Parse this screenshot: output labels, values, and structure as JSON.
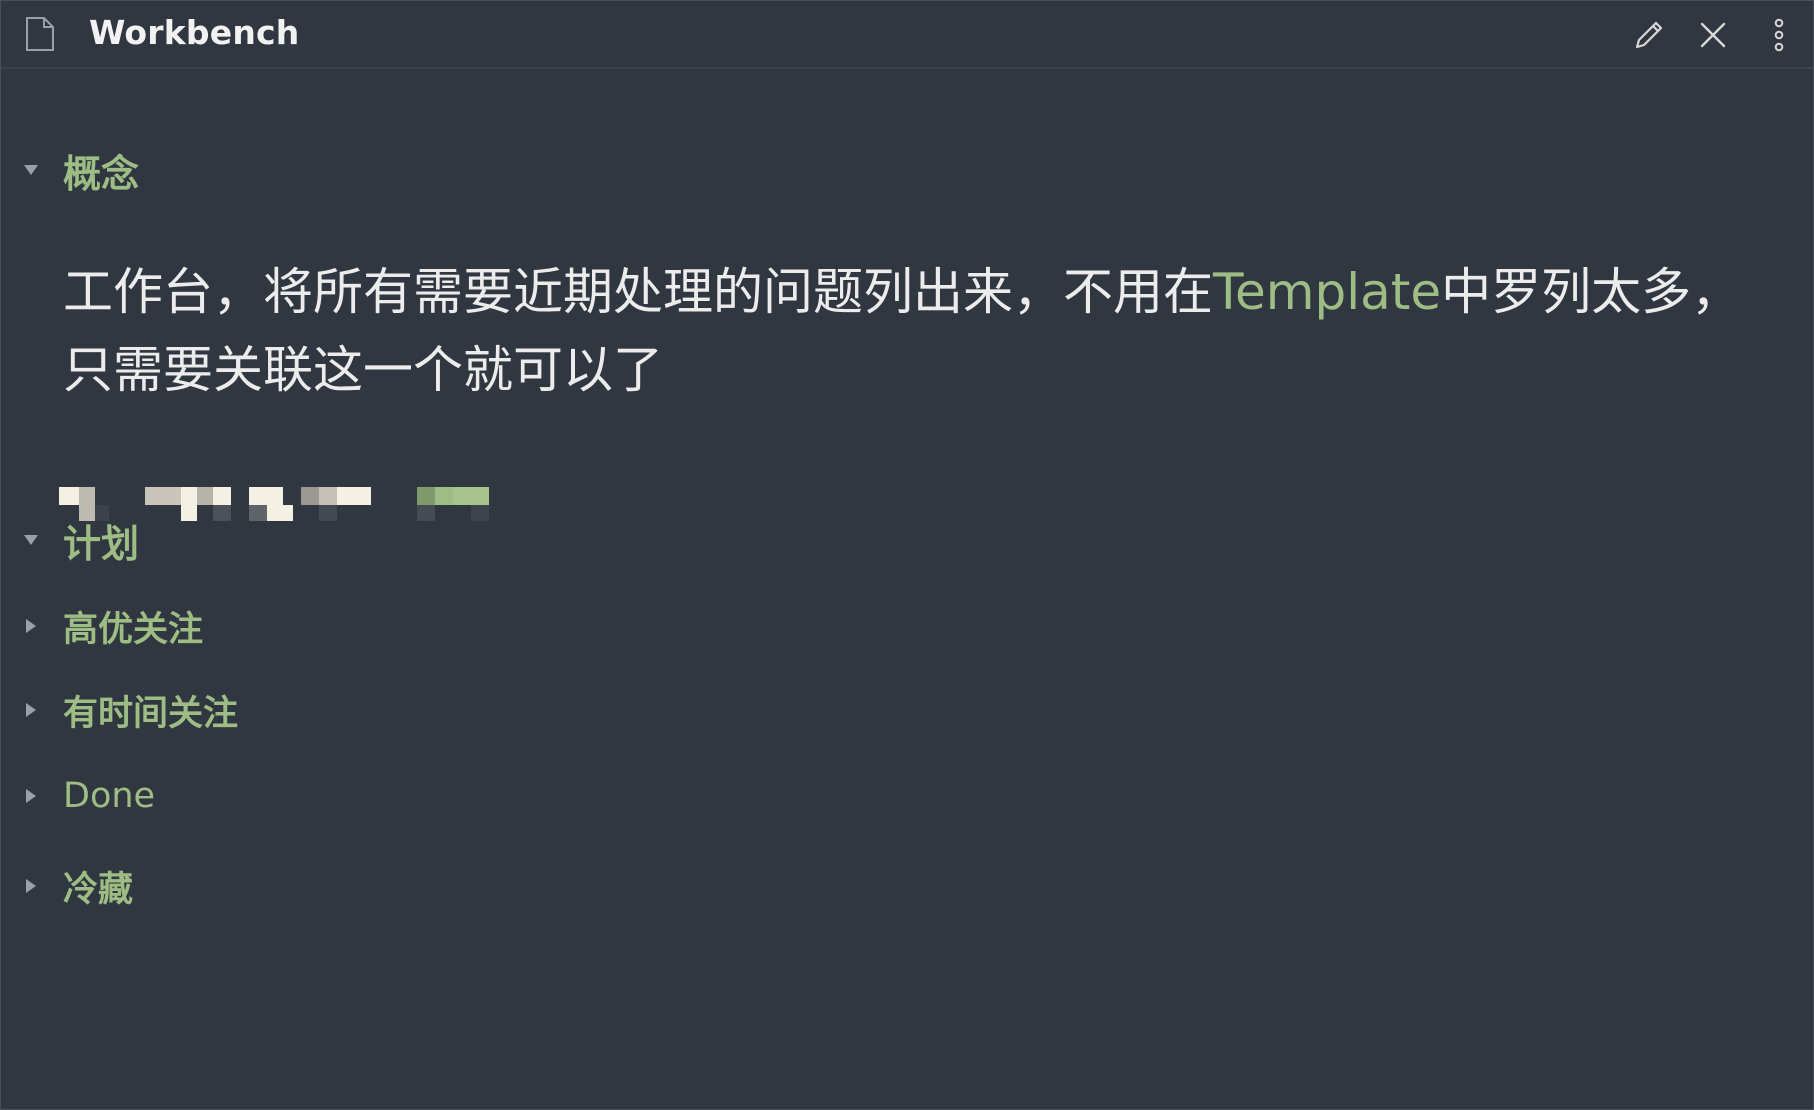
{
  "window": {
    "title": "Workbench",
    "actions": {
      "edit_icon": "pencil-icon",
      "close_icon": "close-icon",
      "more_icon": "more-vertical-icon"
    }
  },
  "sections": {
    "concept": {
      "label": "概念",
      "expanded": true
    },
    "plan": {
      "label": "计划",
      "expanded": true
    },
    "high_priority": {
      "label": "高优关注",
      "expanded": false
    },
    "timed": {
      "label": "有时间关注",
      "expanded": false
    },
    "done": {
      "label": "Done",
      "expanded": false
    },
    "cold": {
      "label": "冷藏",
      "expanded": false
    }
  },
  "concept_text": {
    "part1": "工作台，将所有需要近期处理的问题列出来，不用在",
    "highlight": "Template",
    "part2": "中罗列太多，只需要关联这一个就可以了"
  },
  "colors": {
    "background": "#313741",
    "heading": "#9ebd84",
    "text": "#ececec",
    "title": "#f2f2f2"
  }
}
